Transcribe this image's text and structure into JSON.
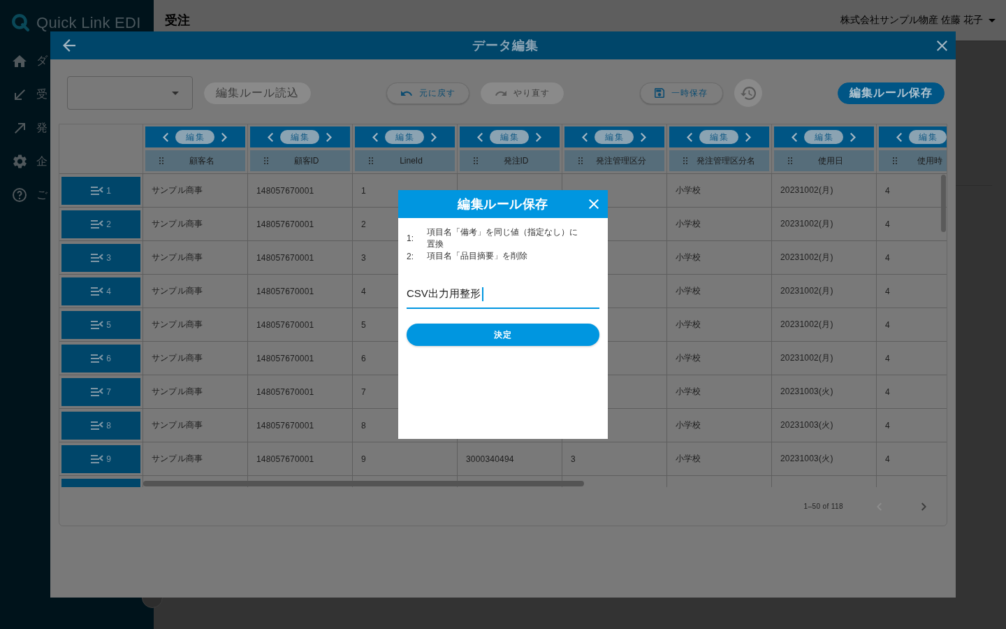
{
  "sidebar": {
    "logo": "Quick Link EDI",
    "items": [
      {
        "label": "ダ"
      },
      {
        "label": "受"
      },
      {
        "label": "発"
      },
      {
        "label": "企"
      },
      {
        "label": "ご"
      }
    ]
  },
  "header": {
    "title": "受注",
    "user": "株式会社サンプル物産 佐藤 花子"
  },
  "modal": {
    "title": "データ編集",
    "toolbar": {
      "groups": [
        [
          {
            "kind": "text",
            "label": "編集ルール読込",
            "disabled": true
          }
        ],
        [
          {
            "kind": "outline",
            "label": "元に戻す",
            "disabled": false
          },
          {
            "kind": "outline",
            "label": "やり直す",
            "disabled": true
          }
        ],
        [
          {
            "kind": "outline",
            "label": "一時保存",
            "disabled": false
          },
          {
            "kind": "round",
            "disabled": true
          }
        ],
        [
          {
            "kind": "primary",
            "label": "編集ルール保存",
            "disabled": false
          }
        ]
      ]
    },
    "table": {
      "columns": [
        {
          "edit": "編集",
          "label": "顧客名"
        },
        {
          "edit": "編集",
          "label": "顧客ID"
        },
        {
          "edit": "編集",
          "label": "LineId"
        },
        {
          "edit": "編集",
          "label": "発注ID"
        },
        {
          "edit": "編集",
          "label": "発注管理区分"
        },
        {
          "edit": "編集",
          "label": "発注管理区分名"
        },
        {
          "edit": "編集",
          "label": "使用日"
        },
        {
          "edit": "編集",
          "label": "使用時"
        }
      ],
      "rows": [
        {
          "number": "1",
          "customer_name": "サンプル商事",
          "customer_id": "148057670001",
          "line_id": "1",
          "order_class_name": "小学校",
          "use_date": "20231002(月)",
          "use_time": "4"
        },
        {
          "number": "2",
          "customer_name": "サンプル商事",
          "customer_id": "148057670001",
          "line_id": "2",
          "order_class_name": "小学校",
          "use_date": "20231002(月)",
          "use_time": "4"
        },
        {
          "number": "3",
          "customer_name": "サンプル商事",
          "customer_id": "148057670001",
          "line_id": "3",
          "order_class_name": "小学校",
          "use_date": "20231002(月)",
          "use_time": "4"
        },
        {
          "number": "4",
          "customer_name": "サンプル商事",
          "customer_id": "148057670001",
          "line_id": "4",
          "order_class_name": "小学校",
          "use_date": "20231002(月)",
          "use_time": "4"
        },
        {
          "number": "5",
          "customer_name": "サンプル商事",
          "customer_id": "148057670001",
          "line_id": "5",
          "order_class_name": "小学校",
          "use_date": "20231002(月)",
          "use_time": "4"
        },
        {
          "number": "6",
          "customer_name": "サンプル商事",
          "customer_id": "148057670001",
          "line_id": "6",
          "order_class_name": "小学校",
          "use_date": "20231002(月)",
          "use_time": "4"
        },
        {
          "number": "7",
          "customer_name": "サンプル商事",
          "customer_id": "148057670001",
          "line_id": "7",
          "order_class_name": "小学校",
          "use_date": "20231003(火)",
          "use_time": "4"
        },
        {
          "number": "8",
          "customer_name": "サンプル商事",
          "customer_id": "148057670001",
          "line_id": "8",
          "order_class_name": "小学校",
          "use_date": "20231003(火)",
          "use_time": "4"
        },
        {
          "number": "9",
          "customer_name": "サンプル商事",
          "customer_id": "148057670001",
          "line_id": "9",
          "order_id": "3000340494",
          "order_class": "3",
          "order_class_name": "小学校",
          "use_date": "20231003(火)",
          "use_time": "4"
        }
      ]
    },
    "pagination": {
      "range": "1–50 of 118",
      "previous_disabled": true,
      "next_disabled": false
    }
  },
  "dialog": {
    "title": "編集ルール保存",
    "rules": [
      {
        "number": "1:",
        "text": "項目名「備考」を同じ値（指定なし）に置換"
      },
      {
        "number": "2:",
        "text": "項目名「品目摘要」を削除"
      }
    ],
    "input": {
      "value": "CSV出力用整形",
      "focused": true
    },
    "button": "決定"
  }
}
